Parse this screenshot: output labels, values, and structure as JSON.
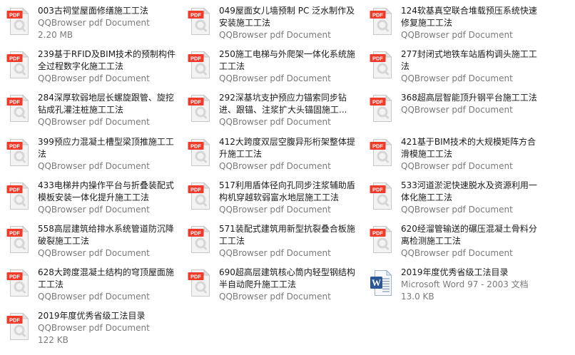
{
  "files": [
    {
      "name": "003古祠堂屋面修缮施工工法",
      "type": "QQBrowser pdf Document",
      "size": "2.20 MB",
      "icon": "pdf-icon"
    },
    {
      "name": "049屋面女儿墙预制 PC 泛水制作及安装施工工法",
      "type": "QQBrowser pdf Document",
      "size": "",
      "icon": "pdf-icon"
    },
    {
      "name": "124软基真空联合堆载预压系统快速修复施工工法",
      "type": "QQBrowser pdf Document",
      "size": "",
      "icon": "pdf-icon"
    },
    {
      "name": "239基于RFID及BIM技术的预制构件全过程数字化施工工法",
      "type": "QQBrowser pdf Document",
      "size": "",
      "icon": "pdf-icon"
    },
    {
      "name": "250施工电梯与外爬架一体化系统施工工法",
      "type": "QQBrowser pdf Document",
      "size": "",
      "icon": "pdf-icon"
    },
    {
      "name": "277封闭式地铁车站盾构调头施工工法",
      "type": "QQBrowser pdf Document",
      "size": "",
      "icon": "pdf-icon"
    },
    {
      "name": "284深厚软弱地层长螺旋跟管、旋挖钻成孔灌注桩施工工法",
      "type": "QQBrowser pdf Document",
      "size": "",
      "icon": "pdf-icon"
    },
    {
      "name": "292深基坑支护预应力锚索同步钻进、跟锚、注浆扩大头锚固施工...",
      "type": "QQBrowser pdf Document",
      "size": "",
      "icon": "pdf-icon"
    },
    {
      "name": "368超高层智能顶升钢平台施工工法",
      "type": "QQBrowser pdf Document",
      "size": "",
      "icon": "pdf-icon"
    },
    {
      "name": "399预应力混凝土槽型梁顶推施工工法",
      "type": "QQBrowser pdf Document",
      "size": "",
      "icon": "pdf-icon"
    },
    {
      "name": "412大跨度双层空腹异形桁架整体提升施工工法",
      "type": "QQBrowser pdf Document",
      "size": "",
      "icon": "pdf-icon"
    },
    {
      "name": "421基于BIM技术的大规模矩阵方合滑模施工工法",
      "type": "QQBrowser pdf Document",
      "size": "",
      "icon": "pdf-icon"
    },
    {
      "name": "433电梯井内操作平台与折叠装配式模板安装一体化提升施工工法",
      "type": "QQBrowser pdf Document",
      "size": "",
      "icon": "pdf-icon"
    },
    {
      "name": "517利用盾体径向孔同步注浆辅助盾构机穿越软弱富水地层施工工法",
      "type": "QQBrowser pdf Document",
      "size": "",
      "icon": "pdf-icon"
    },
    {
      "name": "533河道淤泥快速脱水及资源利用一体化施工工法",
      "type": "QQBrowser pdf Document",
      "size": "",
      "icon": "pdf-icon"
    },
    {
      "name": "558高层建筑给排水系统管道防沉降破裂施工工法",
      "type": "QQBrowser pdf Document",
      "size": "",
      "icon": "pdf-icon"
    },
    {
      "name": "571装配式建筑用新型抗裂叠合板施工工法",
      "type": "QQBrowser pdf Document",
      "size": "",
      "icon": "pdf-icon"
    },
    {
      "name": "620经溜管输送的碾压混凝土骨料分离检测施工工法",
      "type": "QQBrowser pdf Document",
      "size": "",
      "icon": "pdf-icon"
    },
    {
      "name": "628大跨度混凝土结构的穹顶屋面施工工法",
      "type": "QQBrowser pdf Document",
      "size": "",
      "icon": "pdf-icon"
    },
    {
      "name": "690超高层建筑核心筒内轻型钢结构半自动爬升施工工法",
      "type": "QQBrowser pdf Document",
      "size": "",
      "icon": "pdf-icon"
    },
    {
      "name": "2019年度优秀省级工法目录",
      "type": "Microsoft Word 97 - 2003 文档",
      "size": "13.0 KB",
      "icon": "word-icon"
    },
    {
      "name": "2019年度优秀省级工法目录",
      "type": "QQBrowser pdf Document",
      "size": "122 KB",
      "icon": "pdf-icon"
    }
  ],
  "pdf_badge_label": "PDF",
  "word_badge_label": "W",
  "colors": {
    "pdf_badge": "#f03b2a",
    "word_badge": "#2b5797",
    "name_text": "#1a1a1a",
    "meta_text": "#7a7a7a"
  }
}
